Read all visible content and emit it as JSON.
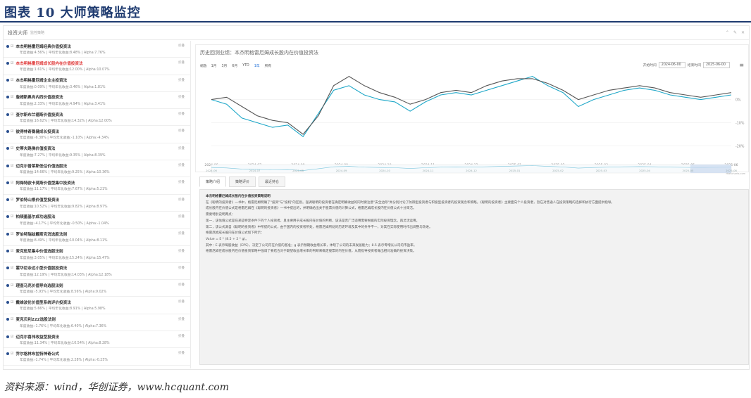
{
  "figure": {
    "title": "图表 10   大师策略监控",
    "source": "资料来源：wind，华创证券，www.hcquant.com"
  },
  "app": {
    "title": "投资大师",
    "subtitle": "监控策略"
  },
  "sidebar": {
    "items": [
      {
        "name": "本杰明格雷厄姆经典价值投资法",
        "tag": "折叠",
        "meta": "年度收益:4.56% | 平均年化收益:8.48% | Alpha:7.76%",
        "active": false
      },
      {
        "name": "本杰明格雷厄姆成长股内在价值投资法",
        "tag": "折叠",
        "meta": "年度收益:1.61% | 平均年化收益:12.00% | Alpha:10.07%",
        "active": true
      },
      {
        "name": "本杰明格雷厄姆企业主投资法",
        "tag": "折叠",
        "meta": "年度收益:0.09% | 平均年化收益:3.46% | Alpha:1.81%",
        "active": false
      },
      {
        "name": "詹姆斯奥肖内西价值投资法",
        "tag": "折叠",
        "meta": "年度收益:2.33% | 平均年化收益:4.94% | Alpha:3.41%",
        "active": false
      },
      {
        "name": "查尔斯布兰德斯价值投资法",
        "tag": "折叠",
        "meta": "年度收益:16.62% | 平均年化收益:14.32% | Alpha:12.00%",
        "active": false
      },
      {
        "name": "彼得林奇稳健成长投资法",
        "tag": "折叠",
        "meta": "年度收益:-6.38% | 平均年化收益:-1.10% | Alpha:-4.34%",
        "active": false
      },
      {
        "name": "史蒂夫路佛价值投资法",
        "tag": "折叠",
        "meta": "年度收益:7.27% | 平均年化收益:9.35% | Alpha:8.39%",
        "active": false
      },
      {
        "name": "迈克尔普莱斯低估价值选股法",
        "tag": "折叠",
        "meta": "年度收益:14.66% | 平均年化收益:9.25% | Alpha:10.36%",
        "active": false
      },
      {
        "name": "阿梅特欧卡莫斯价值型集中投资法",
        "tag": "折叠",
        "meta": "年度收益:11.17% | 平均年化收益:7.67% | Alpha:5.21%",
        "active": false
      },
      {
        "name": "罗伯特山根价值型投资法",
        "tag": "折叠",
        "meta": "年度收益:10.52% | 平均年化收益:9.82% | Alpha:8.97%",
        "active": false
      },
      {
        "name": "柏顿墨基尔成功选股法",
        "tag": "折叠",
        "meta": "年度收益:-4.17% | 平均年化收益:-0.50% | Alpha:-1.04%",
        "active": false
      },
      {
        "name": "罗伯特瑞兹戴斯克消选股法则",
        "tag": "折叠",
        "meta": "年度收益:8.49% | 平均年化收益:10.04% | Alpha:8.11%",
        "active": false
      },
      {
        "name": "麦克班尼集中价值选股法则",
        "tag": "折叠",
        "meta": "年度收益:3.05% | 平均年化收益:15.24% | Alpha:15.47%",
        "active": false
      },
      {
        "name": "霍华尼佘迈小型价值股投资法",
        "tag": "折叠",
        "meta": "年度收益:12.19% | 平均年化收益:14.03% | Alpha:12.18%",
        "active": false
      },
      {
        "name": "理查马克价值导向选股法则",
        "tag": "折叠",
        "meta": "年度收益:-5.93% | 平均年化收益:8.56% | Alpha:9.02%",
        "active": false
      },
      {
        "name": "戴维波伦价值型系统评价投资法",
        "tag": "折叠",
        "meta": "年度收益:5.66% | 平均年化收益:8.91% | Alpha:5.98%",
        "active": false
      },
      {
        "name": "麦克贝利222选股法则",
        "tag": "折叠",
        "meta": "年度收益:-1.76% | 平均年化收益:6.40% | Alpha:7.36%",
        "active": false
      },
      {
        "name": "迈克尔喜伟收益型投资法",
        "tag": "折叠",
        "meta": "年度收益:11.34% | 平均年化收益:10.54% | Alpha:8.28%",
        "active": false
      },
      {
        "name": "乔尔格林布拉特神奇公式",
        "tag": "折叠",
        "meta": "年度收益:-1.74% | 平均年化收益:2.28% | Alpha:-0.25%",
        "active": false
      }
    ]
  },
  "chart_panel": {
    "title": "历史回测业绩：本杰明格雷厄姆成长股内在价值投资法",
    "zoom_label": "缩放",
    "zoom_options": [
      "1月",
      "3月",
      "6月",
      "YTD",
      "1年",
      "所有"
    ],
    "zoom_selected": "1年",
    "start_label": "开始时间",
    "start_value": "2024-06-00",
    "end_label": "结束时间",
    "end_value": "2025-06-00"
  },
  "chart_data": {
    "type": "line",
    "x": [
      "2024-06",
      "2024-07",
      "2024-08",
      "2024-09",
      "2024-10",
      "2024-11",
      "2024-12",
      "2025-01",
      "2025-02",
      "2025-03",
      "2025-04",
      "2025-05",
      "2025-06"
    ],
    "y_tick_labels": [
      "0%",
      "-10%",
      "-20%"
    ],
    "ylim": [
      -25,
      12
    ],
    "series": [
      {
        "color": "#1ea7c8",
        "values": [
          0,
          -2,
          -8,
          -10,
          -12,
          -11,
          -16,
          -6,
          4,
          6,
          2,
          0,
          -1,
          -5,
          -1,
          2,
          3,
          2,
          4,
          6,
          8,
          10,
          6,
          3,
          -3,
          0,
          2,
          4,
          5,
          4,
          2,
          1,
          0,
          1,
          2
        ]
      },
      {
        "color": "#555555",
        "values": [
          0,
          1,
          -3,
          -7,
          -9,
          -10,
          -15,
          -7,
          6,
          10,
          6,
          3,
          1,
          -2,
          0,
          3,
          4,
          3,
          6,
          8,
          9,
          9,
          7,
          4,
          0,
          2,
          4,
          5,
          6,
          5,
          3,
          2,
          1,
          2,
          3
        ]
      }
    ],
    "navigator_x_labels": [
      "2024-06",
      "2024-07",
      "2024-08",
      "2024-09",
      "2024-10",
      "2024-11",
      "2024-12",
      "2025-01",
      "2025-02",
      "2025-03",
      "2025-04",
      "2025-05",
      "2025-06"
    ],
    "credit": "Highcharts.com"
  },
  "tabs": {
    "items": [
      "策略介绍",
      "策略评价",
      "最近持仓"
    ],
    "selected": 0
  },
  "description": {
    "heading": "本杰明格雷厄姆成长股内在价值投资策略说明",
    "paragraphs": [
      "在《聪明的投资者》一书中，格雷厄姆明确了\"投资\"与\"投机\"的区别。强调聪明的投资者在确定明确收益的同时要注意\"安全边际\"并分别讨论了防御型投资者与积极型投资者的投资观念和策略。《聪明的投资者》主要面向个人投资者，旨在对普通人在投资策略的选择和执行方面提供指导。",
      "成长股内在价值公式是格雷厄姆在《聪明的投资者》一书中提出的，并明确给出关于股票价值的计算公式，格雷厄姆成长股内在价值公式十分简洁。",
      "需要特别说明两点：",
      "第一，该估值公式是在某些特定条件下的个人投资者，且主要用于成长股内在价值的判断，该法是否广泛适用需要根据的实际投资理念，再灵活运用。",
      "第二，该公式源自《聪明的投资者》中所提的公式，由于国内的投资者所处，格雷厄姆所处的历史环境及其中的条件不一，对其在实际使用时作出调整与改进。",
      "格雷厄姆成长股内在价值公式如下所示：",
      "Value = E * (8.5 + 2 * g)。",
      "其中：E 表示每股收益（EPS），决定了公司内在价值的基准；g 表示预期收益增长率，体现了公司的未来发展能力；8.5 表示零增长公司的市盈率。",
      "格雷厄姆在成长股内在价值投资策略中强调了要结合对于期望收益增长率的判断来确定股票的内在价值，从而指导投资者做出相对准确的投资决策。"
    ]
  }
}
